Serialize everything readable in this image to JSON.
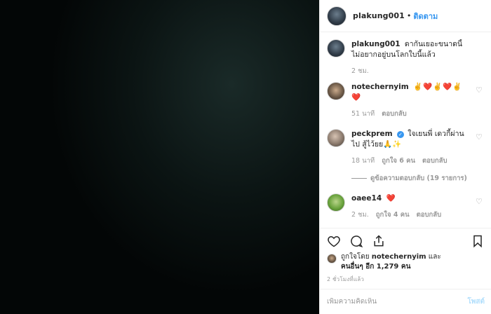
{
  "post": {
    "username": "plakung001",
    "separator": "•",
    "follow_label": "ติดตาม"
  },
  "caption": {
    "username": "plakung001",
    "text": "ดากันเยอะขนาดนี้ ไม่อยากอยู่บนโลกใบนี้แล้ว",
    "time": "2 ชม."
  },
  "comments": [
    {
      "username": "notechernyim",
      "text": "✌️❤️✌️❤️✌️❤️",
      "time": "51 นาที",
      "likes": "",
      "reply_label": "ตอบกลับ",
      "avatar": "note-avatar"
    },
    {
      "username": "peckprem",
      "text": "ใจเยนพี่ เดวกี้ผ่านไป สู้ไว้ยย🙏✨",
      "time": "18 นาที",
      "likes": "ถูกใจ 6 คน",
      "reply_label": "ตอบกลับ",
      "view_replies": "ดูข้อความตอบกลับ (19 รายการ)",
      "verified": true,
      "avatar": "peck-avatar"
    },
    {
      "username": "oaee14",
      "text": "❤️",
      "time": "2 ชม.",
      "likes": "ถูกใจ 4 คน",
      "reply_label": "ตอบกลับ",
      "avatar": "oaee-avatar"
    }
  ],
  "actions": {
    "like_icon": "heart-icon",
    "comment_icon": "comment-icon",
    "share_icon": "share-icon",
    "save_icon": "bookmark-icon"
  },
  "likes_summary": {
    "prefix": "ถูกใจโดย",
    "first_user": "notechernyim",
    "and": "และ",
    "others": "คนอื่นๆ อีก 1,279 คน"
  },
  "posted_ago": "2 ชั่วโมงที่แล้ว",
  "add_comment": {
    "placeholder": "เพิ่มความคิดเห็น",
    "post_label": "โพสต์"
  },
  "colors": {
    "link_blue": "#3897f0",
    "heart_red": "#e0245e",
    "muted_gray": "#999999",
    "post_disabled": "#b2dffc"
  }
}
